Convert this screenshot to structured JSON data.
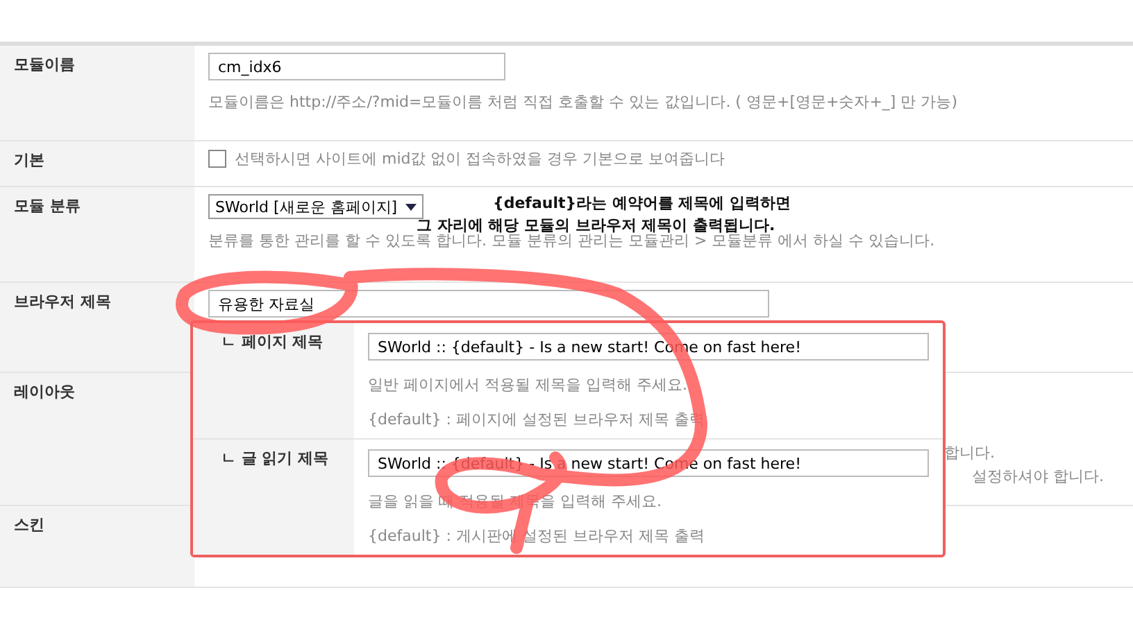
{
  "rows": [
    {
      "label": "모듈이름",
      "kind": "text",
      "value": "cm_idx6",
      "help": "모듈이름은 http://주소/?mid=모듈이름 처럼 직접 호출할 수 있는 값입니다. ( 영문+[영문+숫자+_] 만 가능)"
    },
    {
      "label": "기본",
      "kind": "checkbox",
      "checked": false,
      "help": "선택하시면 사이트에 mid값 없이 접속하였을 경우 기본으로 보여줍니다"
    },
    {
      "label": "모듈 분류",
      "kind": "select",
      "value": "SWorld [새로운 홈페이지]",
      "help": "분류를 통한 관리를 할 수 있도록 합니다. 모듈 분류의 관리는 모듈관리 > 모듈분류 에서 하실 수 있습니다."
    },
    {
      "label": "브라우저 제목",
      "kind": "text",
      "value": "유용한 자료실"
    },
    {
      "label": "레이아웃",
      "kind": "hidden",
      "fragments": [
        "합니다.",
        "설정하셔야 합니다."
      ]
    },
    {
      "label": "스킨",
      "kind": "empty"
    }
  ],
  "popup": {
    "rows": [
      {
        "label": "ㄴ 페이지 제목",
        "value": "SWorld :: {default} - Is a new start! Come on fast here!",
        "help": [
          "일반 페이지에서 적용될 제목을 입력해 주세요.",
          "{default} : 페이지에 설정된 브라우저 제목 출력"
        ]
      },
      {
        "label": "ㄴ 글 읽기 제목",
        "value": "SWorld :: {default} - Is a new start! Come on fast here!",
        "help": [
          "글을 읽을 때 적용될 제목을 입력해 주세요.",
          "{default} : 게시판에 설정된 브라우저 제목 출력"
        ]
      }
    ]
  },
  "annotation": [
    "{default}라는 예약어를 제목에 입력하면",
    "그 자리에 해당 모듈의 브라우저 제목이 출력됩니다."
  ]
}
